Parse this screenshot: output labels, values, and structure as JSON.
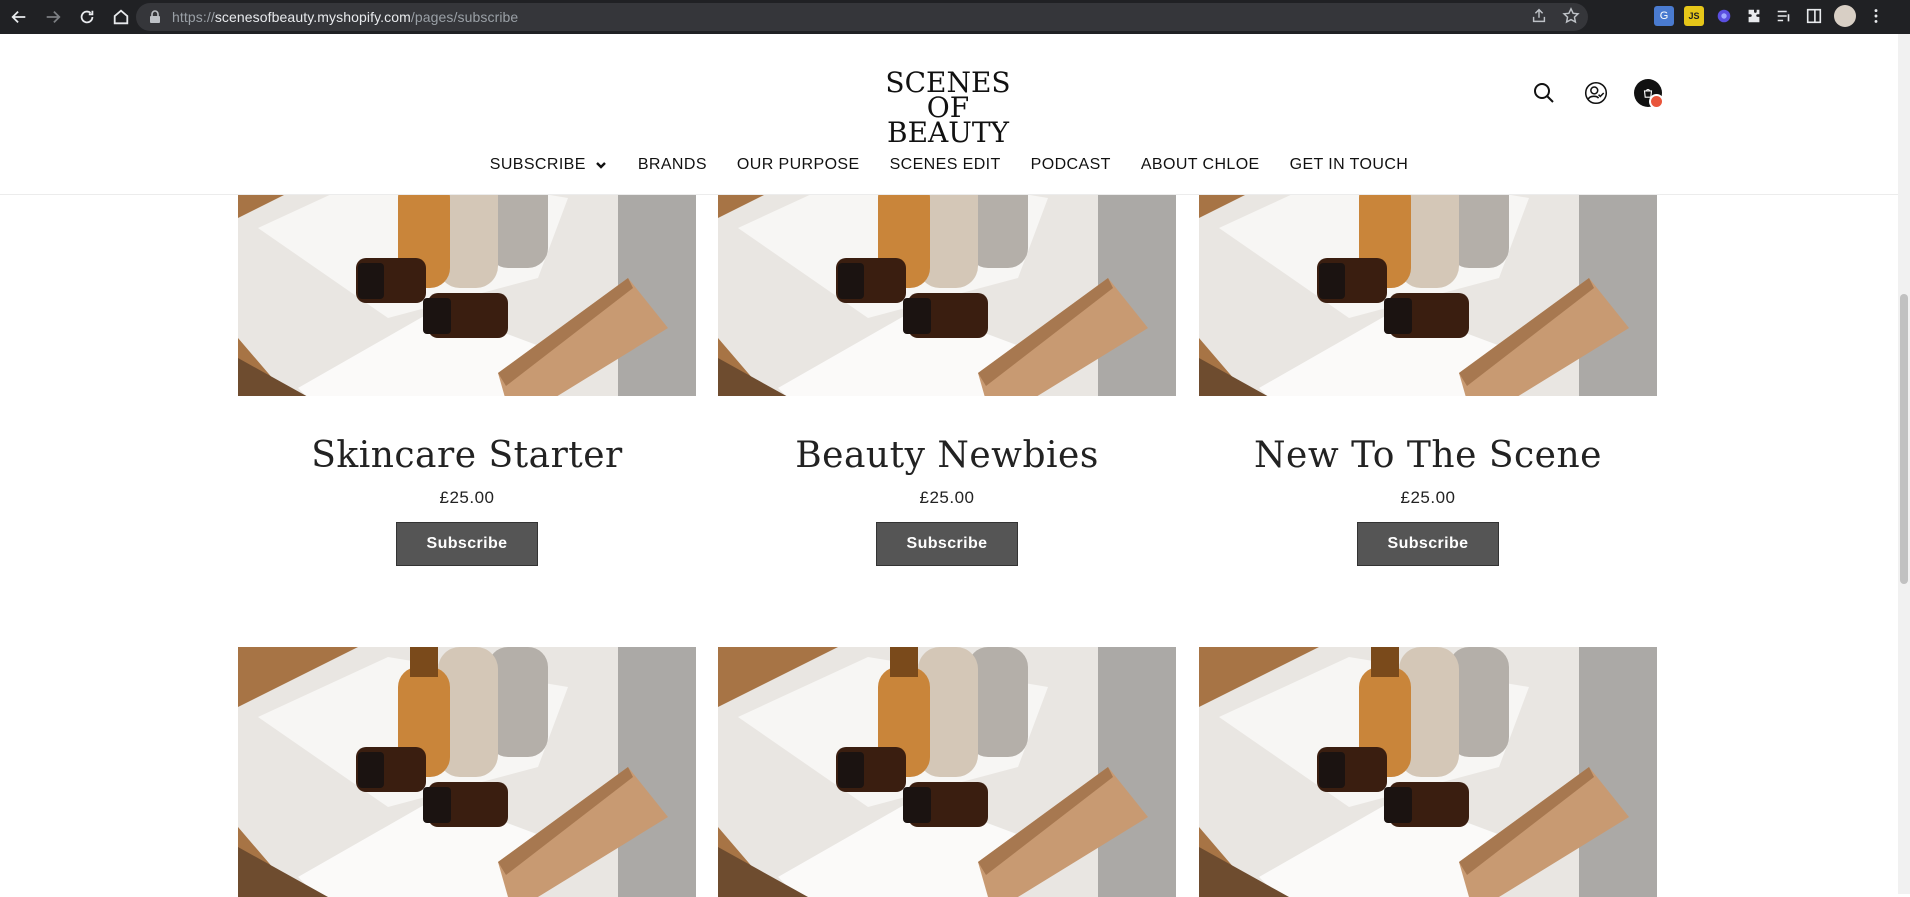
{
  "browser": {
    "url_scheme": "https://",
    "url_host": "scenesofbeauty.myshopify.com",
    "url_path": "/pages/subscribe"
  },
  "header": {
    "logo_line1": "SCENES",
    "logo_line2": "OF BEAUTY",
    "nav": [
      {
        "label": "SUBSCRIBE"
      },
      {
        "label": "BRANDS"
      },
      {
        "label": "OUR PURPOSE"
      },
      {
        "label": "SCENES EDIT"
      },
      {
        "label": "PODCAST"
      },
      {
        "label": "ABOUT CHLOE"
      },
      {
        "label": "GET IN TOUCH"
      }
    ]
  },
  "products": [
    {
      "title": "Skincare Starter",
      "price": "£25.00",
      "button": "Subscribe"
    },
    {
      "title": "Beauty Newbies",
      "price": "£25.00",
      "button": "Subscribe"
    },
    {
      "title": "New To The Scene",
      "price": "£25.00",
      "button": "Subscribe"
    }
  ],
  "icons": {
    "back": "back-arrow-icon",
    "forward": "forward-arrow-icon",
    "reload": "reload-icon",
    "home": "home-icon",
    "search": "search-icon",
    "account": "account-icon",
    "cart": "cart-icon"
  },
  "colors": {
    "button_bg": "#555555",
    "cart_badge": "#e9553b"
  }
}
